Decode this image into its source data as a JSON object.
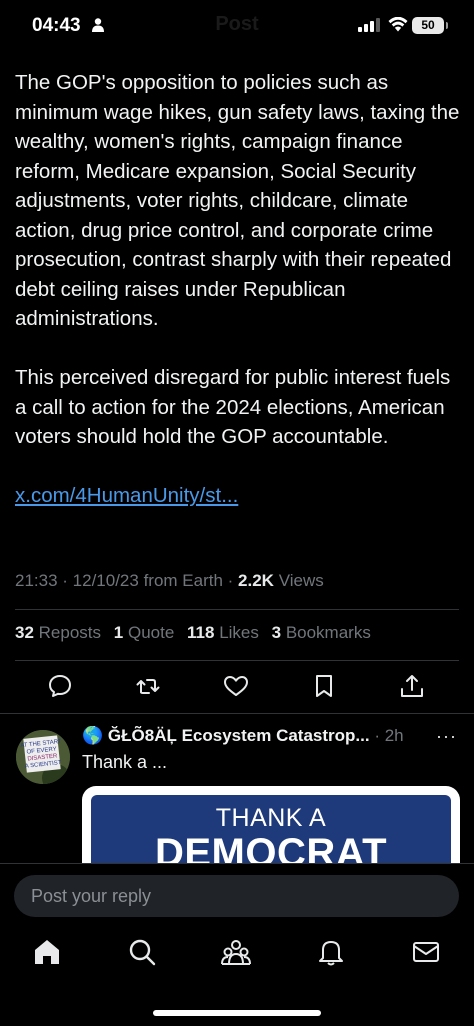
{
  "status_bar": {
    "time": "04:43",
    "battery": "50",
    "person_icon": "person-icon",
    "signal_icon": "cellular-signal-icon",
    "wifi_icon": "wifi-icon"
  },
  "header": {
    "title": "Post"
  },
  "tweet": {
    "paragraphs": [
      "The GOP's opposition to policies such as minimum wage hikes, gun safety laws, taxing the wealthy, women's rights, campaign finance reform, Medicare expansion, Social Security adjustments, voter rights, childcare, climate action, drug price control, and corporate crime prosecution, contrast sharply with their repeated debt ceiling raises under Republican administrations.",
      "This perceived disregard for public interest fuels a call to action for the 2024 elections, American voters should hold the GOP accountable."
    ],
    "link": "x.com/4HumanUnity/st...",
    "time": "21:33",
    "date": "12/10/23",
    "source": "from Earth",
    "views_count": "2.2K",
    "views_label": "Views"
  },
  "stats": {
    "reposts_count": "32",
    "reposts_label": "Reposts",
    "quotes_count": "1",
    "quotes_label": "Quote",
    "likes_count": "118",
    "likes_label": "Likes",
    "bookmarks_count": "3",
    "bookmarks_label": "Bookmarks"
  },
  "actions": {
    "reply_icon": "reply-icon",
    "repost_icon": "repost-icon",
    "like_icon": "heart-icon",
    "bookmark_icon": "bookmark-icon",
    "share_icon": "share-icon"
  },
  "reply": {
    "avatar_lines": [
      "AT THE START",
      "OF EVERY",
      "DISASTER",
      "A SCIENTIST"
    ],
    "emoji": "🌎",
    "name": "ĞŁÕ8ÄĻ Ecosystem Catastrop...",
    "time": "2h",
    "more": "···",
    "text": "Thank a ...",
    "image_line1": "THANK A",
    "image_line2": "DEMOCRAT"
  },
  "compose": {
    "placeholder": "Post your reply"
  },
  "bottom_nav": [
    "home-icon",
    "search-icon",
    "communities-icon",
    "notifications-icon",
    "messages-icon"
  ],
  "colors": {
    "background": "#000000",
    "text": "#e7e9ea",
    "secondary": "#71767b",
    "link": "#4a99e9",
    "divider": "#2f3336",
    "input_bg": "#202327"
  }
}
